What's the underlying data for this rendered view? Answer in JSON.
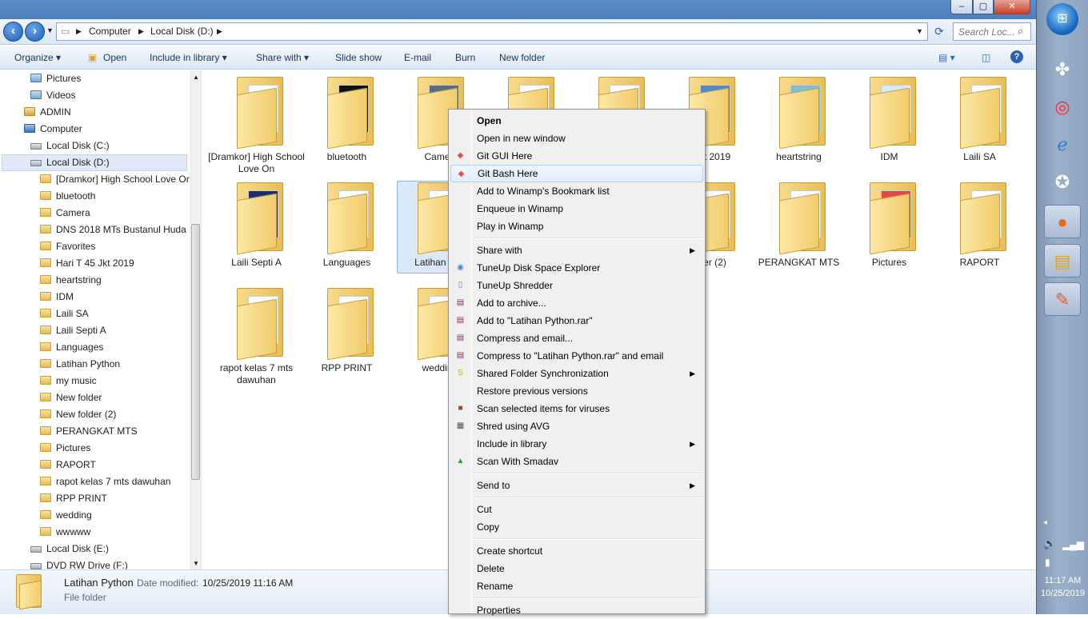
{
  "window": {
    "controls": {
      "minimize": "–",
      "maximize": "▢",
      "close": "✕"
    }
  },
  "nav": {
    "back": "‹",
    "forward": "›",
    "breadcrumb": [
      "Computer",
      "Local Disk (D:)"
    ],
    "search_placeholder": "Search Loc..."
  },
  "commands": [
    "Organize ▾",
    "Open",
    "Include in library ▾",
    "Share with ▾",
    "Slide show",
    "E-mail",
    "Burn",
    "New folder"
  ],
  "tree": [
    {
      "label": "Pictures",
      "icon": "lib"
    },
    {
      "label": "Videos",
      "icon": "lib"
    },
    {
      "label": "ADMIN",
      "icon": "user"
    },
    {
      "label": "Computer",
      "icon": "comp"
    },
    {
      "label": "Local Disk (C:)",
      "icon": "drv"
    },
    {
      "label": "Local Disk (D:)",
      "icon": "drv"
    },
    {
      "label": "[Dramkor] High School Love On",
      "icon": "fold"
    },
    {
      "label": "bluetooth",
      "icon": "fold"
    },
    {
      "label": "Camera",
      "icon": "fold"
    },
    {
      "label": "DNS 2018 MTs Bustanul Huda",
      "icon": "fold"
    },
    {
      "label": "Favorites",
      "icon": "fold"
    },
    {
      "label": "Hari T 45 Jkt 2019",
      "icon": "fold"
    },
    {
      "label": "heartstring",
      "icon": "fold"
    },
    {
      "label": "IDM",
      "icon": "fold"
    },
    {
      "label": "Laili SA",
      "icon": "fold"
    },
    {
      "label": "Laili Septi A",
      "icon": "fold"
    },
    {
      "label": "Languages",
      "icon": "fold"
    },
    {
      "label": "Latihan Python",
      "icon": "fold"
    },
    {
      "label": "my music",
      "icon": "fold"
    },
    {
      "label": "New folder",
      "icon": "fold"
    },
    {
      "label": "New folder (2)",
      "icon": "fold"
    },
    {
      "label": "PERANGKAT MTS",
      "icon": "fold"
    },
    {
      "label": "Pictures",
      "icon": "fold"
    },
    {
      "label": "RAPORT",
      "icon": "fold"
    },
    {
      "label": "rapot kelas 7 mts dawuhan",
      "icon": "fold"
    },
    {
      "label": "RPP PRINT",
      "icon": "fold"
    },
    {
      "label": "wedding",
      "icon": "fold"
    },
    {
      "label": "wwwww",
      "icon": "fold"
    },
    {
      "label": "Local Disk (E:)",
      "icon": "drv"
    },
    {
      "label": "DVD RW Drive (F:)",
      "icon": "drv"
    }
  ],
  "tiles": [
    {
      "label": "[Dramkor] High School Love On",
      "thumb": "#fff"
    },
    {
      "label": "bluetooth",
      "thumb": "#111"
    },
    {
      "label": "Came",
      "thumb": "#5a6b7c"
    },
    {
      "label": "",
      "thumb": "#fff"
    },
    {
      "label": "",
      "thumb": "#fff"
    },
    {
      "label": "5 Jkt 2019",
      "thumb": "#4f8cc4"
    },
    {
      "label": "heartstring",
      "thumb": "#7cc1d6"
    },
    {
      "label": "IDM",
      "thumb": "#dbe9f2"
    },
    {
      "label": "Laili SA",
      "thumb": "#fff"
    },
    {
      "label": "Laili Septi A",
      "thumb": "#1d2d6b"
    },
    {
      "label": "Languages",
      "thumb": "#fff"
    },
    {
      "label": "Latihan Py",
      "thumb": "#fff"
    },
    {
      "label": "",
      "thumb": "#fff"
    },
    {
      "label": "",
      "thumb": "#fff"
    },
    {
      "label": "older (2)",
      "thumb": "#fff"
    },
    {
      "label": "PERANGKAT MTS",
      "thumb": "#fff"
    },
    {
      "label": "Pictures",
      "thumb": "#e04848"
    },
    {
      "label": "RAPORT",
      "thumb": "#fff"
    },
    {
      "label": "rapot kelas 7 mts dawuhan",
      "thumb": "#fff"
    },
    {
      "label": "RPP PRINT",
      "thumb": "#fff"
    },
    {
      "label": "weddin",
      "thumb": "#fff"
    }
  ],
  "context_menu": [
    {
      "label": "Open",
      "bold": true
    },
    {
      "label": "Open in new window"
    },
    {
      "label": "Git GUI Here",
      "icon": "◆",
      "color": "#d9534f"
    },
    {
      "label": "Git Bash Here",
      "icon": "◆",
      "color": "#d9534f",
      "highlight": true
    },
    {
      "label": "Add to Winamp's Bookmark list"
    },
    {
      "label": "Enqueue in Winamp"
    },
    {
      "label": "Play in Winamp"
    },
    {
      "sep": true
    },
    {
      "label": "Share with",
      "sub": true
    },
    {
      "label": "TuneUp Disk Space Explorer",
      "icon": "◉",
      "color": "#4a8ac9"
    },
    {
      "label": "TuneUp Shredder",
      "icon": "▯",
      "color": "#4a8ac9"
    },
    {
      "label": "Add to archive...",
      "icon": "▤",
      "color": "#8b2b6b"
    },
    {
      "label": "Add to \"Latihan Python.rar\"",
      "icon": "▤",
      "color": "#8b2b6b"
    },
    {
      "label": "Compress and email...",
      "icon": "▤",
      "color": "#8b2b6b"
    },
    {
      "label": "Compress to \"Latihan Python.rar\" and email",
      "icon": "▤",
      "color": "#8b2b6b"
    },
    {
      "label": "Shared Folder Synchronization",
      "icon": "S",
      "color": "#e8a020",
      "sub": true
    },
    {
      "label": "Restore previous versions"
    },
    {
      "label": "Scan selected items for viruses",
      "icon": "■",
      "color": "#c0392b"
    },
    {
      "label": "Shred using AVG",
      "icon": "▦",
      "color": "#555"
    },
    {
      "label": "Include in library",
      "sub": true
    },
    {
      "label": "Scan With Smadav",
      "icon": "▲",
      "color": "#2a9d3a"
    },
    {
      "sep": true
    },
    {
      "label": "Send to",
      "sub": true
    },
    {
      "sep": true
    },
    {
      "label": "Cut"
    },
    {
      "label": "Copy"
    },
    {
      "sep": true
    },
    {
      "label": "Create shortcut"
    },
    {
      "label": "Delete"
    },
    {
      "label": "Rename"
    },
    {
      "sep": true
    },
    {
      "label": "Properties"
    }
  ],
  "status": {
    "name": "Latihan Python",
    "date_label": "Date modified:",
    "date_value": "10/25/2019 11:16 AM",
    "type": "File folder"
  },
  "taskbar": {
    "time": "11:17 AM",
    "date": "10/25/2019"
  }
}
